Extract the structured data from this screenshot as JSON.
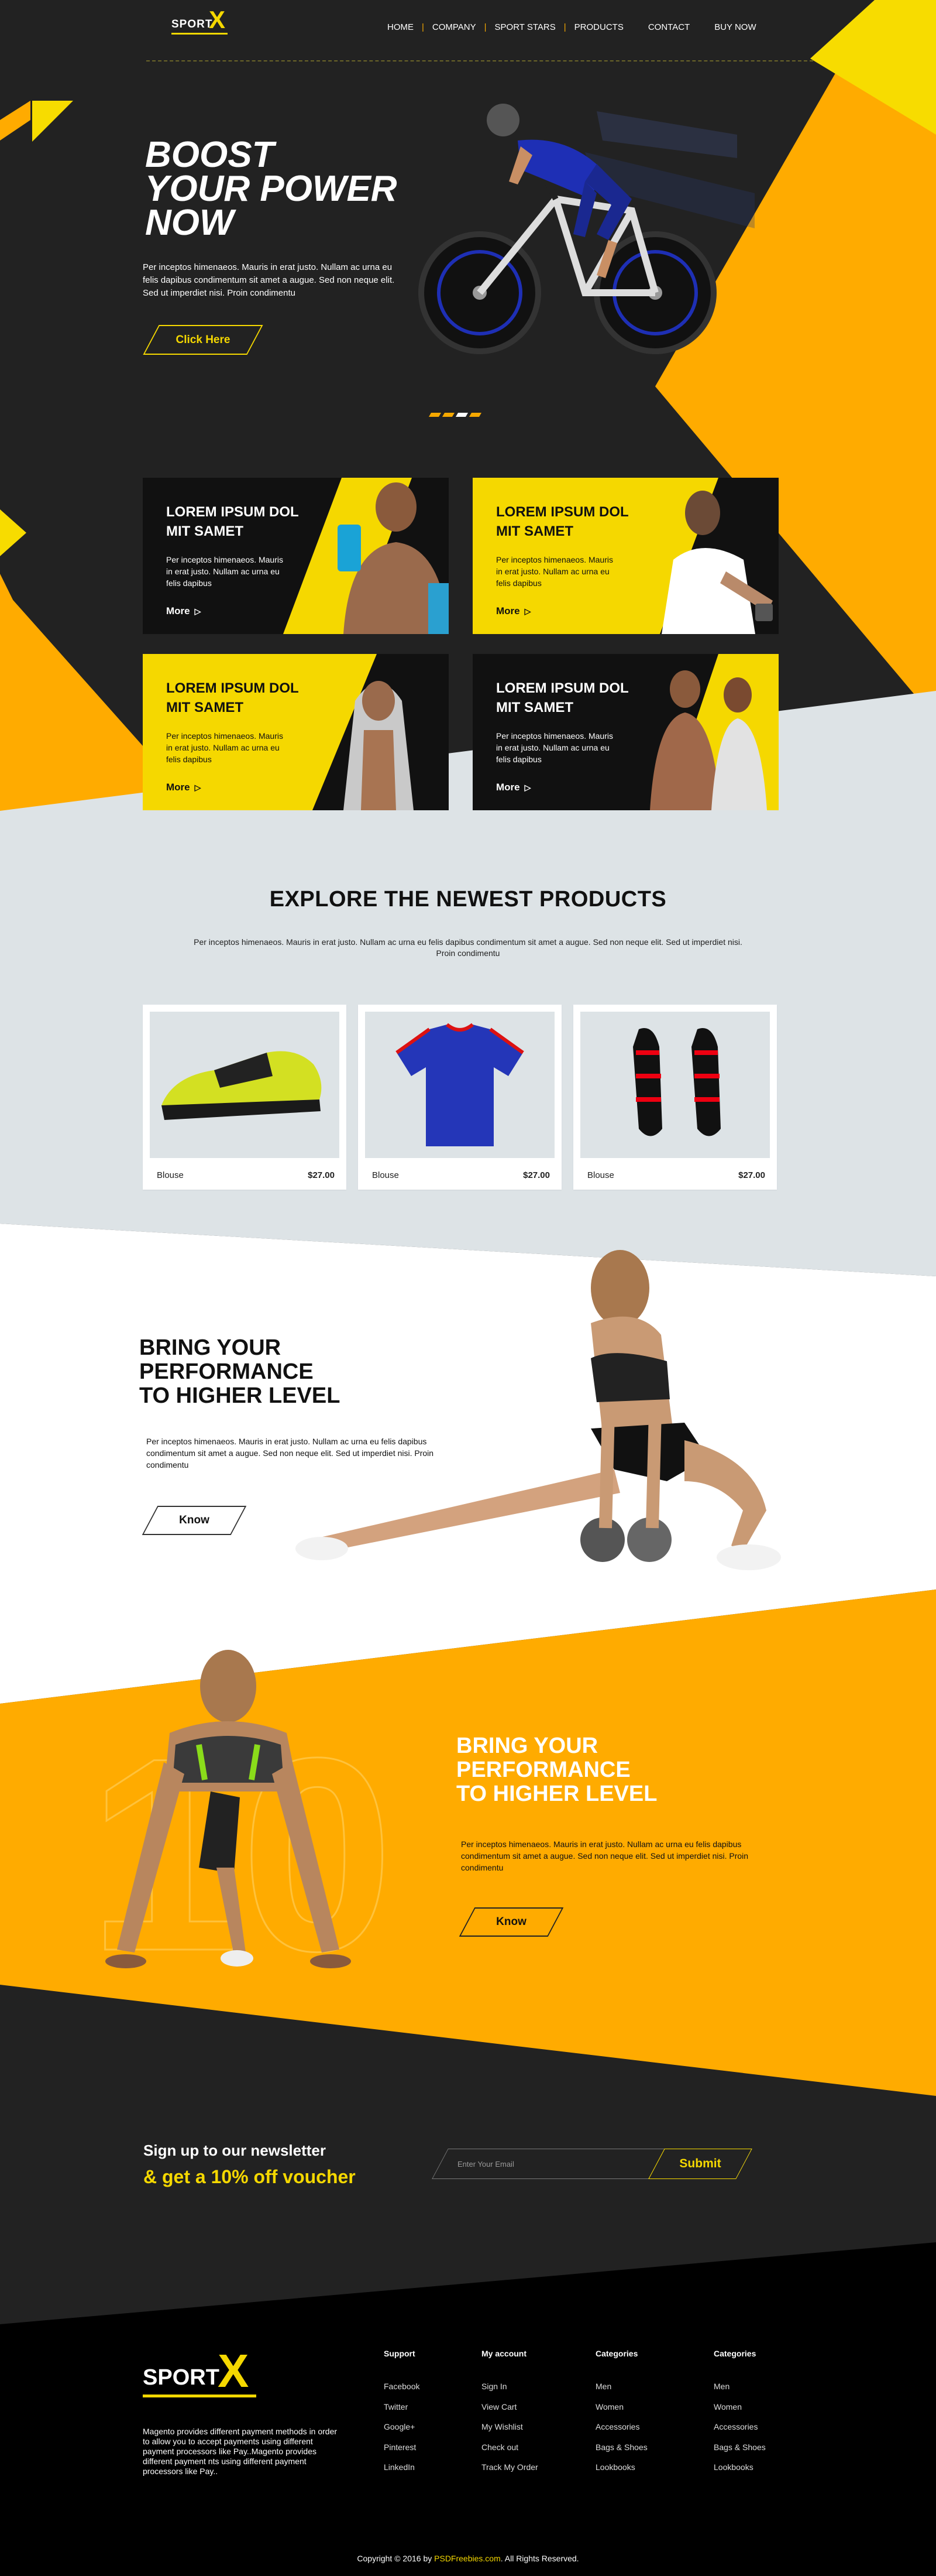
{
  "brand": {
    "logo_text": "SPORT",
    "logo_mark": "X"
  },
  "nav": {
    "items": [
      "HOME",
      "COMPANY",
      "SPORT STARS",
      "PRODUCTS",
      "CONTACT",
      "BUY NOW"
    ]
  },
  "hero": {
    "title": "BOOST\nYOUR POWER\nNOW",
    "text": "Per inceptos himenaeos. Mauris in erat justo. Nullam ac urna eu felis dapibus condimentum sit amet a augue. Sed non neque elit. Sed ut imperdiet nisi. Proin condimentu",
    "button": "Click Here",
    "slides_count": 4,
    "active_slide": 3
  },
  "cards": [
    {
      "title": "LOREM IPSUM DOL MIT SAMET",
      "text": "Per inceptos himenaeos. Mauris in erat justo. Nullam ac urna eu felis dapibus",
      "more": "More",
      "theme": "dark"
    },
    {
      "title": "LOREM IPSUM DOL MIT SAMET",
      "text": "Per inceptos himenaeos. Mauris in erat justo. Nullam ac urna eu felis dapibus",
      "more": "More",
      "theme": "yellow"
    },
    {
      "title": "LOREM IPSUM DOL MIT SAMET",
      "text": "Per inceptos himenaeos. Mauris in erat justo. Nullam ac urna eu felis dapibus",
      "more": "More",
      "theme": "yellow"
    },
    {
      "title": "LOREM IPSUM DOL MIT SAMET",
      "text": "Per inceptos himenaeos. Mauris in erat justo. Nullam ac urna eu felis dapibus",
      "more": "More",
      "theme": "dark"
    }
  ],
  "products_section": {
    "title": "EXPLORE THE NEWEST PRODUCTS",
    "text": "Per inceptos himenaeos. Mauris in erat justo. Nullam ac urna eu felis dapibus condimentum sit amet a augue. Sed non neque elit. Sed ut imperdiet nisi. Proin condimentu",
    "items": [
      {
        "name": "Blouse",
        "price": "$27.00",
        "image": "football-boot-icon"
      },
      {
        "name": "Blouse",
        "price": "$27.00",
        "image": "tshirt-icon"
      },
      {
        "name": "Blouse",
        "price": "$27.00",
        "image": "cleats-pair-icon"
      }
    ]
  },
  "performance1": {
    "title": "BRING YOUR\nPERFORMANCE\nTO HIGHER LEVEL",
    "text": "Per inceptos himenaeos. Mauris in erat justo. Nullam ac urna eu felis dapibus condimentum sit amet a augue. Sed non neque elit. Sed ut imperdiet nisi. Proin condimentu",
    "button": "Know"
  },
  "performance2": {
    "title": "BRING YOUR\nPERFORMANCE\nTO HIGHER LEVEL",
    "text": "Per inceptos himenaeos. Mauris in erat justo. Nullam ac urna eu felis dapibus condimentum sit amet a augue. Sed non neque elit. Sed ut imperdiet nisi. Proin condimentu",
    "button": "Know",
    "bg_number": "10"
  },
  "newsletter": {
    "line1": "Sign up to our newsletter",
    "line2": "& get a 10% off voucher",
    "placeholder": "Enter Your Email",
    "submit": "Submit"
  },
  "footer": {
    "logo_text": "SPORT",
    "logo_mark": "X",
    "about": "Magento provides different payment methods in order to allow you to accept payments using different payment processors like Pay..Magento provides different payment nts using different payment processors like Pay..",
    "columns": [
      {
        "heading": "Support",
        "links": [
          "Facebook",
          "Twitter",
          "Google+",
          "Pinterest",
          "LinkedIn"
        ]
      },
      {
        "heading": "My account",
        "links": [
          "Sign In",
          "View Cart",
          "My Wishlist",
          "Check out",
          "Track My Order"
        ]
      },
      {
        "heading": "Categories",
        "links": [
          "Men",
          "Women",
          "Accessories",
          "Bags & Shoes",
          "Lookbooks"
        ]
      },
      {
        "heading": "Categories",
        "links": [
          "Men",
          "Women",
          "Accessories",
          "Bags & Shoes",
          "Lookbooks"
        ]
      }
    ],
    "copyright_prefix": "Copyright © 2016 by",
    "copyright_link": "PSDFreebies.com",
    "copyright_suffix": ". All Rights Reserved."
  },
  "colors": {
    "yellow": "#f5d800",
    "orange": "#ffab00",
    "dark": "#222222",
    "light_gray": "#dde3e6",
    "black": "#000000"
  }
}
